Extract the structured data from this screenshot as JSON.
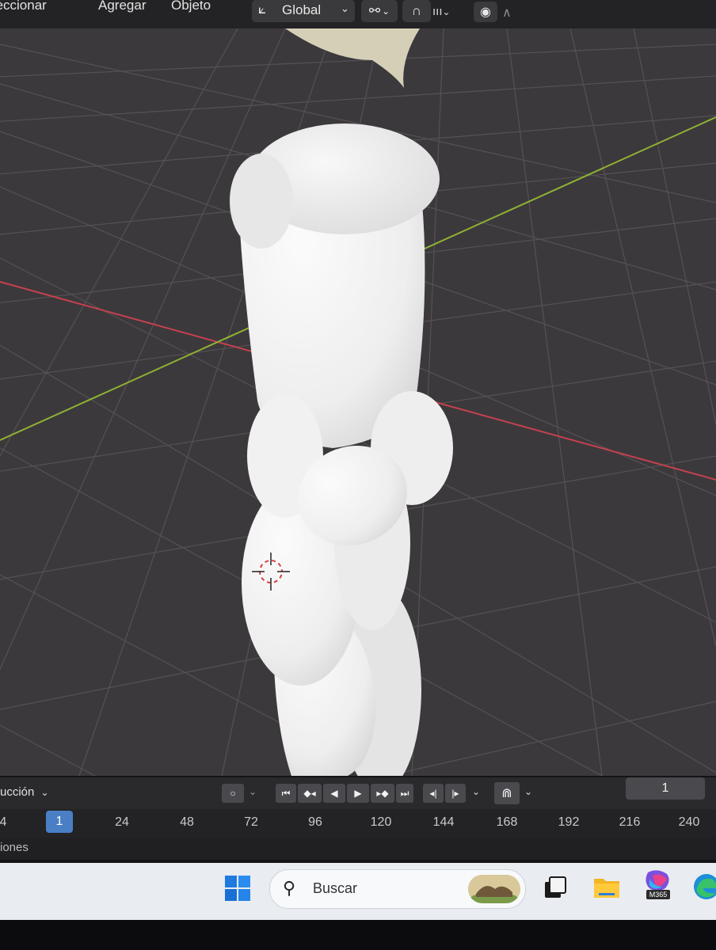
{
  "header": {
    "menu": [
      "Seleccionar",
      "Agregar",
      "Objeto"
    ],
    "transform_orientation": "Global",
    "icons": [
      "orientation-axes-icon",
      "pivot-link-icon",
      "snap-magnet-icon",
      "snap-increment-icon",
      "proportional-edit-icon",
      "falloff-curve-icon"
    ]
  },
  "timeline": {
    "mode_label": "ucción",
    "current_frame": "1",
    "ruler_ticks": [
      "4",
      "1",
      "24",
      "48",
      "72",
      "96",
      "120",
      "144",
      "168",
      "192",
      "216",
      "240"
    ],
    "active_tick": "1",
    "lower_label": "iones"
  },
  "taskbar": {
    "search_placeholder": "Buscar",
    "apps": [
      "start-icon",
      "search-icon",
      "widget-landscape-icon",
      "task-view-icon",
      "file-explorer-icon",
      "m365-icon",
      "edge-icon"
    ],
    "m365_label": "M365"
  },
  "colors": {
    "grid_bg": "#3c393c",
    "x_axis": "#c8414e",
    "y_axis": "#8fb234",
    "active_frame": "#4a7fc6"
  }
}
